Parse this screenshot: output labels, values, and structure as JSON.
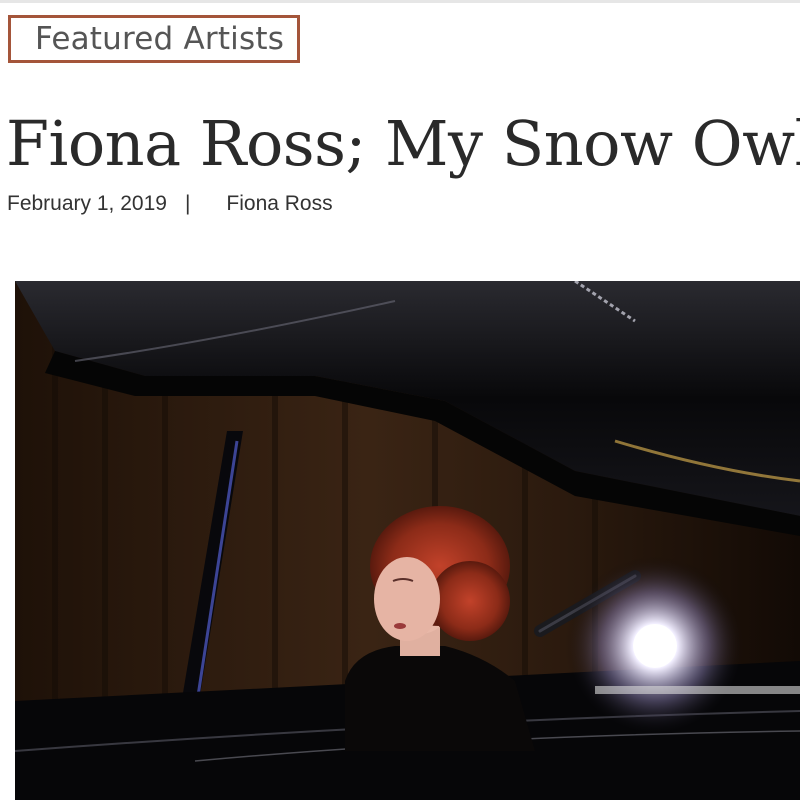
{
  "post": {
    "category": "Featured Artists",
    "title": "Fiona Ross; My Snow Owl E",
    "date": "February 1, 2019",
    "separator": "|",
    "author": "Fiona Ross"
  },
  "hero_image": {
    "description_icon": "photo"
  },
  "colors": {
    "tag_border": "#a4553a",
    "title_text": "#2a2a2a",
    "meta_text": "#333333"
  }
}
